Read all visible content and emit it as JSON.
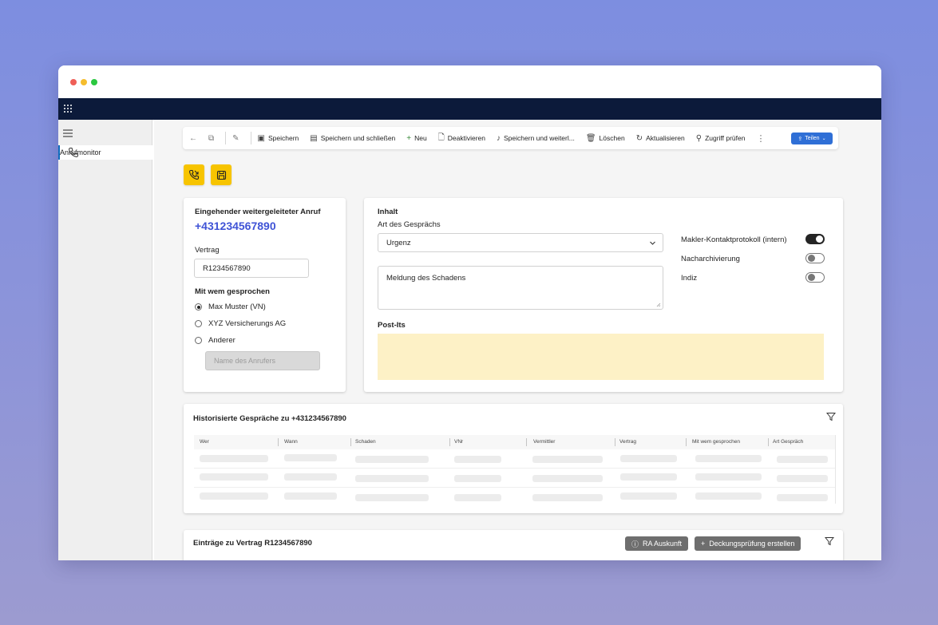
{
  "toolbar": {
    "save": "Speichern",
    "save_close": "Speichern und schließen",
    "new": "Neu",
    "deactivate": "Deaktivieren",
    "save_forward": "Speichern und weiterl...",
    "delete": "Löschen",
    "refresh": "Aktualisieren",
    "check_access": "Zugriff prüfen",
    "share": "Teilen"
  },
  "sidebar": {
    "items": [
      {
        "label": "Anrufmonitor",
        "icon": "phone-icon"
      }
    ]
  },
  "call_card": {
    "title": "Eingehender weitergeleiteter Anruf",
    "phone": "+431234567890",
    "contract_label": "Vertrag",
    "contract_value": "R1234567890",
    "spoken_with_label": "Mit wem gesprochen",
    "options": [
      {
        "label": "Max Muster (VN)",
        "selected": true
      },
      {
        "label": "XYZ Versicherungs AG",
        "selected": false
      },
      {
        "label": "Anderer",
        "selected": false
      }
    ],
    "caller_name_placeholder": "Name des Anrufers"
  },
  "content_card": {
    "title": "Inhalt",
    "type_label": "Art des Gesprächs",
    "type_value": "Urgenz",
    "description": "Meldung des Schadens",
    "postits_label": "Post-Its",
    "toggles": [
      {
        "label": "Makler-Kontaktprotokoll (intern)",
        "on": true
      },
      {
        "label": "Nacharchivierung",
        "on": false
      },
      {
        "label": "Indiz",
        "on": false
      }
    ]
  },
  "history": {
    "title": "Historisierte Gespräche zu +431234567890",
    "columns": [
      "Wer",
      "Wann",
      "Schaden",
      "VNr",
      "Vermittler",
      "Vertrag",
      "Mit wem gesprochen",
      "Art Gespräch"
    ]
  },
  "entries": {
    "title": "Einträge zu Vertrag R1234567890",
    "ra_button": "RA Auskunft",
    "coverage_button": "Deckungsprüfung erstellen"
  },
  "colors": {
    "accent_blue": "#3f53d6",
    "nav_dark": "#0c1a3a",
    "action_yellow": "#f7c400",
    "postit_yellow": "#fdf1c6",
    "share_blue": "#2f6fd6"
  }
}
